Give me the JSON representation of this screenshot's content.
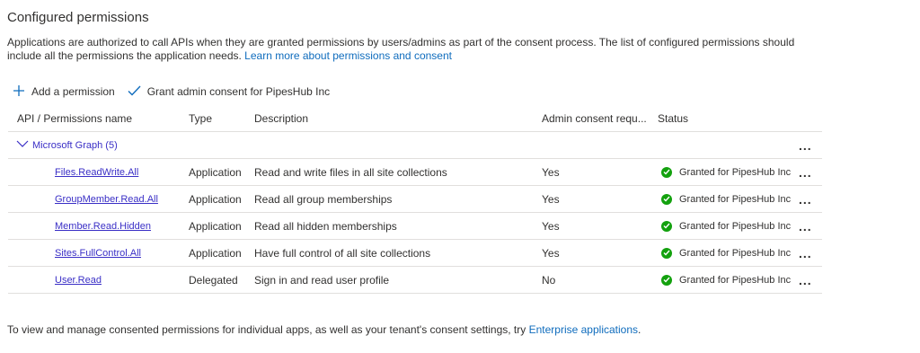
{
  "page": {
    "title": "Configured permissions",
    "description": "Applications are authorized to call APIs when they are granted permissions by users/admins as part of the consent process. The list of configured permissions should include all the permissions the application needs.",
    "learn_more_link": "Learn more about permissions and consent"
  },
  "toolbar": {
    "add_permission": "Add a permission",
    "grant_consent": "Grant admin consent for PipesHub Inc"
  },
  "table": {
    "headers": {
      "name": "API / Permissions name",
      "type": "Type",
      "description": "Description",
      "admin": "Admin consent requ...",
      "status": "Status"
    },
    "group": {
      "label": "Microsoft Graph (5)",
      "more": "..."
    },
    "rows": [
      {
        "name": "Files.ReadWrite.All",
        "type": "Application",
        "description": "Read and write files in all site collections",
        "admin": "Yes",
        "status": "Granted for PipesHub Inc",
        "more": "..."
      },
      {
        "name": "GroupMember.Read.All",
        "type": "Application",
        "description": "Read all group memberships",
        "admin": "Yes",
        "status": "Granted for PipesHub Inc",
        "more": "..."
      },
      {
        "name": "Member.Read.Hidden",
        "type": "Application",
        "description": "Read all hidden memberships",
        "admin": "Yes",
        "status": "Granted for PipesHub Inc",
        "more": "..."
      },
      {
        "name": "Sites.FullControl.All",
        "type": "Application",
        "description": "Have full control of all site collections",
        "admin": "Yes",
        "status": "Granted for PipesHub Inc",
        "more": "..."
      },
      {
        "name": "User.Read",
        "type": "Delegated",
        "description": "Sign in and read user profile",
        "admin": "No",
        "status": "Granted for PipesHub Inc",
        "more": "..."
      }
    ]
  },
  "footer": {
    "text": "To view and manage consented permissions for individual apps, as well as your tenant's consent settings, try",
    "link": "Enterprise applications",
    "suffix": "."
  },
  "colors": {
    "link": "#0f6cbd",
    "permission_link": "#3a2fc6",
    "granted": "#13a10e",
    "divider": "#e1dfdd"
  }
}
